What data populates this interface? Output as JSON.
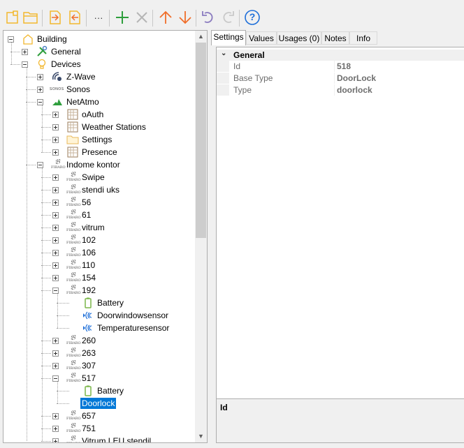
{
  "toolbar": {
    "buttons": [
      "new-document-icon",
      "open-folder-icon",
      "import-icon",
      "export-icon",
      "more-icon",
      "add-icon",
      "delete-icon",
      "move-up-icon",
      "move-down-icon",
      "undo-icon",
      "redo-icon",
      "help-icon"
    ],
    "more_label": "···",
    "help_label": "?"
  },
  "tree": {
    "items": [
      {
        "label": "Building"
      },
      {
        "label": "General"
      },
      {
        "label": "Devices"
      },
      {
        "label": "Z-Wave"
      },
      {
        "label": "Sonos"
      },
      {
        "label": "NetAtmo"
      },
      {
        "label": "oAuth"
      },
      {
        "label": "Weather Stations"
      },
      {
        "label": "Settings"
      },
      {
        "label": "Presence"
      },
      {
        "label": "Indome kontor"
      },
      {
        "label": "Swipe"
      },
      {
        "label": "stendi uks"
      },
      {
        "label": "56"
      },
      {
        "label": "61"
      },
      {
        "label": "vitrum"
      },
      {
        "label": "102"
      },
      {
        "label": "106"
      },
      {
        "label": "110"
      },
      {
        "label": "154"
      },
      {
        "label": "192"
      },
      {
        "label": "Battery"
      },
      {
        "label": "Doorwindowsensor"
      },
      {
        "label": "Temperaturesensor"
      },
      {
        "label": "260"
      },
      {
        "label": "263"
      },
      {
        "label": "307"
      },
      {
        "label": "517"
      },
      {
        "label": "Battery"
      },
      {
        "label": "Doorlock"
      },
      {
        "label": "657"
      },
      {
        "label": "751"
      },
      {
        "label": "Vitrum LEU stendil"
      }
    ],
    "sonos_logo": "SONOS",
    "fibaro_mark": "FIBARO"
  },
  "tabs": [
    "Settings",
    "Values",
    "Usages (0)",
    "Notes",
    "Info"
  ],
  "properties": {
    "category": "General",
    "rows": [
      {
        "name": "Id",
        "value": "518"
      },
      {
        "name": "Base Type",
        "value": "DoorLock"
      },
      {
        "name": "Type",
        "value": "doorlock"
      }
    ]
  },
  "description": {
    "title": "Id"
  },
  "colors": {
    "selection": "#0078d7",
    "add": "#2e9e3c",
    "arrows": "#f06e2a",
    "icons": "#f2b72e",
    "help": "#1e6fd9"
  }
}
